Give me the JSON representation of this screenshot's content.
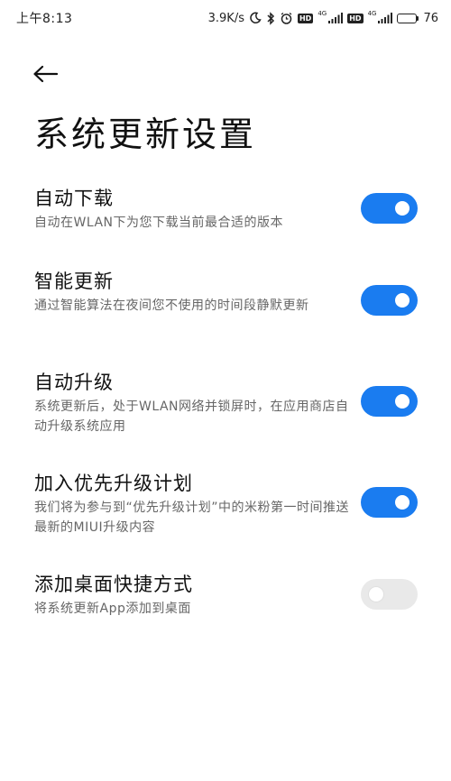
{
  "status_bar": {
    "time": "上午8:13",
    "speed": "3.9K/s",
    "net_label_1": "4G",
    "net_label_2": "4G",
    "hd_1": "HD",
    "hd_2": "HD",
    "battery_text": "76",
    "battery_level": 0.76,
    "icons": [
      "moon-icon",
      "bluetooth-icon",
      "alarm-icon",
      "signal-icon",
      "battery-icon"
    ]
  },
  "header": {
    "back_icon": "back-arrow-icon",
    "title": "系统更新设置"
  },
  "settings": [
    {
      "title": "自动下载",
      "desc": "自动在WLAN下为您下载当前最合适的版本",
      "enabled": true
    },
    {
      "title": "智能更新",
      "desc": "通过智能算法在夜间您不使用的时间段静默更新",
      "enabled": true
    },
    {
      "title": "自动升级",
      "desc": "系统更新后，处于WLAN网络并锁屏时，在应用商店自动升级系统应用",
      "enabled": true
    },
    {
      "title": "加入优先升级计划",
      "desc": "我们将为参与到“优先升级计划”中的米粉第一时间推送最新的MIUI升级内容",
      "enabled": true
    },
    {
      "title": "添加桌面快捷方式",
      "desc": "将系统更新App添加到桌面",
      "enabled": false
    }
  ],
  "colors": {
    "toggle_on": "#1a7cf0",
    "toggle_off": "#e9e9e9"
  }
}
